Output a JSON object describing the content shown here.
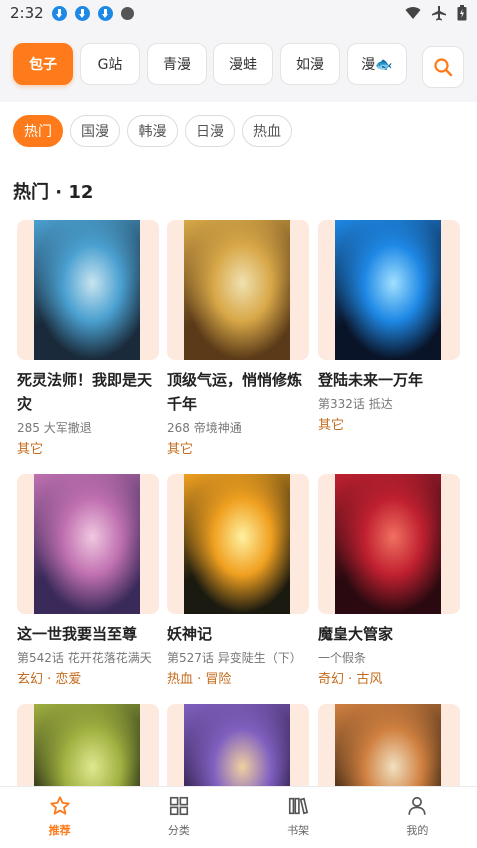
{
  "status_bar": {
    "time": "2:32"
  },
  "sources": {
    "tabs": [
      {
        "label": "包子",
        "active": true
      },
      {
        "label": "G站"
      },
      {
        "label": "青漫"
      },
      {
        "label": "漫蛙"
      },
      {
        "label": "如漫"
      },
      {
        "label": "漫🐟"
      }
    ]
  },
  "genres": [
    "热门",
    "国漫",
    "韩漫",
    "日漫",
    "热血"
  ],
  "section": {
    "title": "热门 · 12"
  },
  "comics": [
    {
      "title": "死灵法师！我即是天灾",
      "sub": "285 大军撤退",
      "tags": "其它",
      "palette": [
        "#1a2a3a",
        "#4aa0d0",
        "#c8e4f0"
      ]
    },
    {
      "title": "顶级气运，悄悄修炼千年",
      "sub": "268 帝境神通",
      "tags": "其它",
      "palette": [
        "#5a3a18",
        "#d8a848",
        "#f0e0b0"
      ]
    },
    {
      "title": "登陆未来一万年",
      "sub": "第332话 抵达",
      "tags": "其它",
      "palette": [
        "#0a1428",
        "#1e88e5",
        "#a0e0ff"
      ]
    },
    {
      "title": "这一世我要当至尊",
      "sub": "第542话 花开花落花满天",
      "tags": "玄幻 · 恋爱",
      "palette": [
        "#3a2a5a",
        "#c070b0",
        "#f0c8e0"
      ]
    },
    {
      "title": "妖神记",
      "sub": "第527话 异变陡生（下）",
      "tags": "热血 · 冒险",
      "palette": [
        "#1a1a10",
        "#f0a020",
        "#fff0a0"
      ]
    },
    {
      "title": "魔皇大管家",
      "sub": "一个假条",
      "tags": "奇幻 · 古风",
      "palette": [
        "#2a0a10",
        "#c02030",
        "#f07060"
      ]
    },
    {
      "title": "",
      "sub": "",
      "tags": "",
      "palette": [
        "#1a2010",
        "#a0b040",
        "#e0e890"
      ]
    },
    {
      "title": "",
      "sub": "",
      "tags": "",
      "palette": [
        "#2a1a40",
        "#8060c0",
        "#f0d0a0"
      ]
    },
    {
      "title": "",
      "sub": "",
      "tags": "",
      "palette": [
        "#302010",
        "#d08040",
        "#f0e0c0"
      ]
    }
  ],
  "bottom_nav": [
    {
      "label": "推荐",
      "icon": "star-icon",
      "active": true
    },
    {
      "label": "分类",
      "icon": "grid-icon"
    },
    {
      "label": "书架",
      "icon": "bookshelf-icon"
    },
    {
      "label": "我的",
      "icon": "person-icon"
    }
  ],
  "colors": {
    "accent": "#ff7a1a",
    "tag": "#c46a1a",
    "cover_bg": "#fde9de"
  }
}
